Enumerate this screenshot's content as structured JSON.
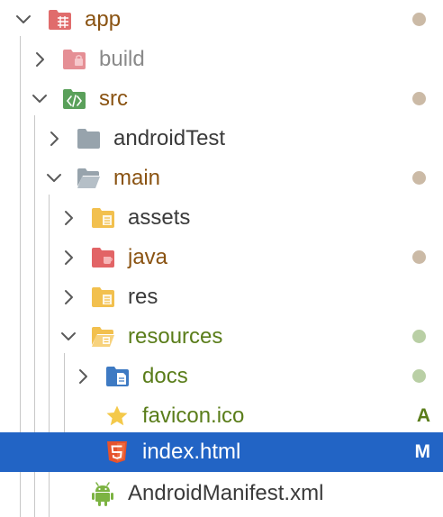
{
  "colors": {
    "text_default": "#3a3a3a",
    "text_modified": "#8a5312",
    "text_ignored": "#8a8a8a",
    "text_new": "#5a7d1a",
    "text_selected": "#ffffff",
    "selection_bg": "#2264c5",
    "dot_modified": "#cbbaa6",
    "dot_new": "#b9cfa5",
    "letter_added": "#5a7d1a",
    "letter_selected": "#ffffff"
  },
  "tree": {
    "items": [
      {
        "label": "app",
        "icon": "folder-module-icon",
        "expanded": true,
        "status": "modified-dot"
      },
      {
        "label": "build",
        "icon": "folder-excluded-icon",
        "expanded": false,
        "status": ""
      },
      {
        "label": "src",
        "icon": "folder-source-icon",
        "expanded": true,
        "status": "modified-dot"
      },
      {
        "label": "androidTest",
        "icon": "folder-icon",
        "expanded": false,
        "status": ""
      },
      {
        "label": "main",
        "icon": "folder-open-icon",
        "expanded": true,
        "status": "modified-dot"
      },
      {
        "label": "assets",
        "icon": "folder-resources-icon",
        "expanded": false,
        "status": ""
      },
      {
        "label": "java",
        "icon": "folder-java-icon",
        "expanded": false,
        "status": "modified-dot"
      },
      {
        "label": "res",
        "icon": "folder-resources-icon",
        "expanded": false,
        "status": ""
      },
      {
        "label": "resources",
        "icon": "folder-resources-open-icon",
        "expanded": true,
        "status": "new-dot"
      },
      {
        "label": "docs",
        "icon": "folder-docs-icon",
        "expanded": false,
        "status": "new-dot"
      },
      {
        "label": "favicon.ico",
        "icon": "star-file-icon",
        "status": "added",
        "status_letter": "A"
      },
      {
        "label": "index.html",
        "icon": "html5-file-icon",
        "status": "modified",
        "status_letter": "M",
        "selected": true
      },
      {
        "label": "AndroidManifest.xml",
        "icon": "android-icon",
        "status": ""
      }
    ]
  }
}
